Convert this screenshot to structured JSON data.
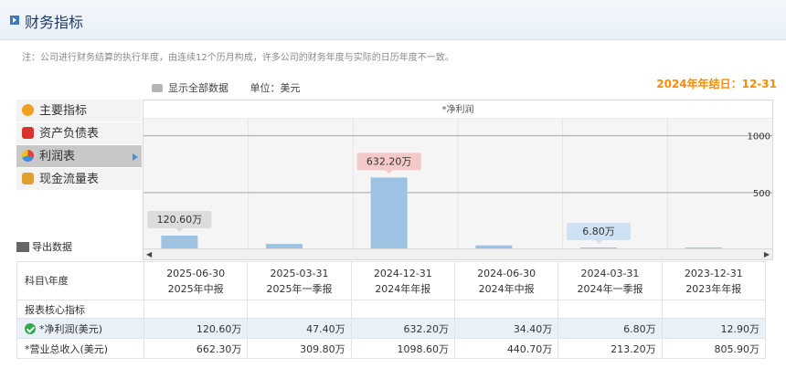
{
  "header": {
    "title": "财务指标"
  },
  "note": "注：公司进行财务结算的执行年度，由连续12个历月构成，许多公司的财务年度与实际的日历年度不一致。",
  "fiscal_year_end": "2024年年结日：12-31",
  "toolbar": {
    "show_all": "显示全部数据",
    "unit": "单位：美元"
  },
  "sidebar": {
    "items": [
      {
        "label": "主要指标",
        "icon": "sun-icon",
        "color": "#f0a020"
      },
      {
        "label": "资产负债表",
        "icon": "sheet-icon",
        "color": "#d9342b"
      },
      {
        "label": "利润表",
        "icon": "pie-icon",
        "color": "#3a8de0",
        "active": true
      },
      {
        "label": "现金流量表",
        "icon": "money-icon",
        "color": "#e0a030"
      }
    ],
    "export": "导出数据"
  },
  "colors": {
    "bar": "#9cc3e4",
    "accent": "#ff8c00",
    "highlight_row": "#e9f0f8"
  },
  "chart_data": {
    "type": "bar",
    "title": "*净利润",
    "categories": [
      "2025-06-30",
      "2025-03-31",
      "2024-12-31",
      "2024-06-30",
      "2024-03-31",
      "2023-12-31"
    ],
    "values": [
      120.6,
      47.4,
      632.2,
      34.4,
      6.8,
      12.9
    ],
    "data_labels": [
      "120.60万",
      "",
      "632.20万",
      "",
      "6.80万",
      ""
    ],
    "label_colors": [
      "#dcdcdc",
      "",
      "#f4c9c9",
      "",
      "#cfe2f3",
      ""
    ],
    "yticks": [
      500,
      1000
    ],
    "ylim": [
      0,
      1150
    ],
    "grid": true
  },
  "table": {
    "corner": "科目\\年度",
    "columns": [
      {
        "date": "2025-06-30",
        "type": "2025年中报"
      },
      {
        "date": "2025-03-31",
        "type": "2025年一季报"
      },
      {
        "date": "2024-12-31",
        "type": "2024年年报"
      },
      {
        "date": "2024-06-30",
        "type": "2024年中报"
      },
      {
        "date": "2024-03-31",
        "type": "2024年一季报"
      },
      {
        "date": "2023-12-31",
        "type": "2023年年报"
      }
    ],
    "section": "报表核心指标",
    "rows": [
      {
        "label": "*净利润(美元)",
        "values": [
          "120.60万",
          "47.40万",
          "632.20万",
          "34.40万",
          "6.80万",
          "12.90万"
        ]
      },
      {
        "label": "*营业总收入(美元)",
        "values": [
          "662.30万",
          "309.80万",
          "1098.60万",
          "440.70万",
          "213.20万",
          "805.90万"
        ]
      }
    ]
  }
}
